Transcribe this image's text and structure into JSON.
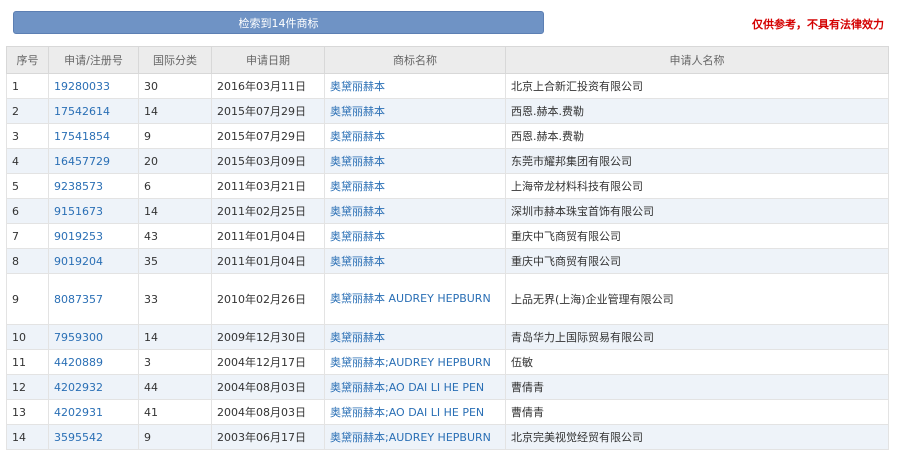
{
  "toolbar": {
    "result_label": "检索到14件商标",
    "disclaimer": "仅供参考，不具有法律效力"
  },
  "table": {
    "headers": [
      "序号",
      "申请/注册号",
      "国际分类",
      "申请日期",
      "商标名称",
      "申请人名称"
    ],
    "rows": [
      {
        "no": "1",
        "reg": "19280033",
        "cls": "30",
        "date": "2016年03月11日",
        "mark": "奥黛丽赫本",
        "applicant": "北京上合新汇投资有限公司"
      },
      {
        "no": "2",
        "reg": "17542614",
        "cls": "14",
        "date": "2015年07月29日",
        "mark": "奥黛丽赫本",
        "applicant": "西恩.赫本.费勒"
      },
      {
        "no": "3",
        "reg": "17541854",
        "cls": "9",
        "date": "2015年07月29日",
        "mark": "奥黛丽赫本",
        "applicant": "西恩.赫本.费勒"
      },
      {
        "no": "4",
        "reg": "16457729",
        "cls": "20",
        "date": "2015年03月09日",
        "mark": "奥黛丽赫本",
        "applicant": "东莞市耀邦集团有限公司"
      },
      {
        "no": "5",
        "reg": "9238573",
        "cls": "6",
        "date": "2011年03月21日",
        "mark": "奥黛丽赫本",
        "applicant": "上海帝龙材料科技有限公司"
      },
      {
        "no": "6",
        "reg": "9151673",
        "cls": "14",
        "date": "2011年02月25日",
        "mark": "奥黛丽赫本",
        "applicant": "深圳市赫本珠宝首饰有限公司"
      },
      {
        "no": "7",
        "reg": "9019253",
        "cls": "43",
        "date": "2011年01月04日",
        "mark": "奥黛丽赫本",
        "applicant": "重庆中飞商贸有限公司"
      },
      {
        "no": "8",
        "reg": "9019204",
        "cls": "35",
        "date": "2011年01月04日",
        "mark": "奥黛丽赫本",
        "applicant": "重庆中飞商贸有限公司"
      },
      {
        "no": "9",
        "reg": "8087357",
        "cls": "33",
        "date": "2010年02月26日",
        "mark": "奥黛丽赫本 AUDREY HEPBURN",
        "applicant": "上品无界(上海)企业管理有限公司"
      },
      {
        "no": "10",
        "reg": "7959300",
        "cls": "14",
        "date": "2009年12月30日",
        "mark": "奥黛丽赫本",
        "applicant": "青岛华力上国际贸易有限公司"
      },
      {
        "no": "11",
        "reg": "4420889",
        "cls": "3",
        "date": "2004年12月17日",
        "mark": "奥黛丽赫本;AUDREY HEPBURN",
        "applicant": "伍敏"
      },
      {
        "no": "12",
        "reg": "4202932",
        "cls": "44",
        "date": "2004年08月03日",
        "mark": "奥黛丽赫本;AO DAI LI HE PEN",
        "applicant": "曹倩青"
      },
      {
        "no": "13",
        "reg": "4202931",
        "cls": "41",
        "date": "2004年08月03日",
        "mark": "奥黛丽赫本;AO DAI LI HE PEN",
        "applicant": "曹倩青"
      },
      {
        "no": "14",
        "reg": "3595542",
        "cls": "9",
        "date": "2003年06月17日",
        "mark": "奥黛丽赫本;AUDREY HEPBURN",
        "applicant": "北京完美视觉经贸有限公司"
      }
    ]
  }
}
